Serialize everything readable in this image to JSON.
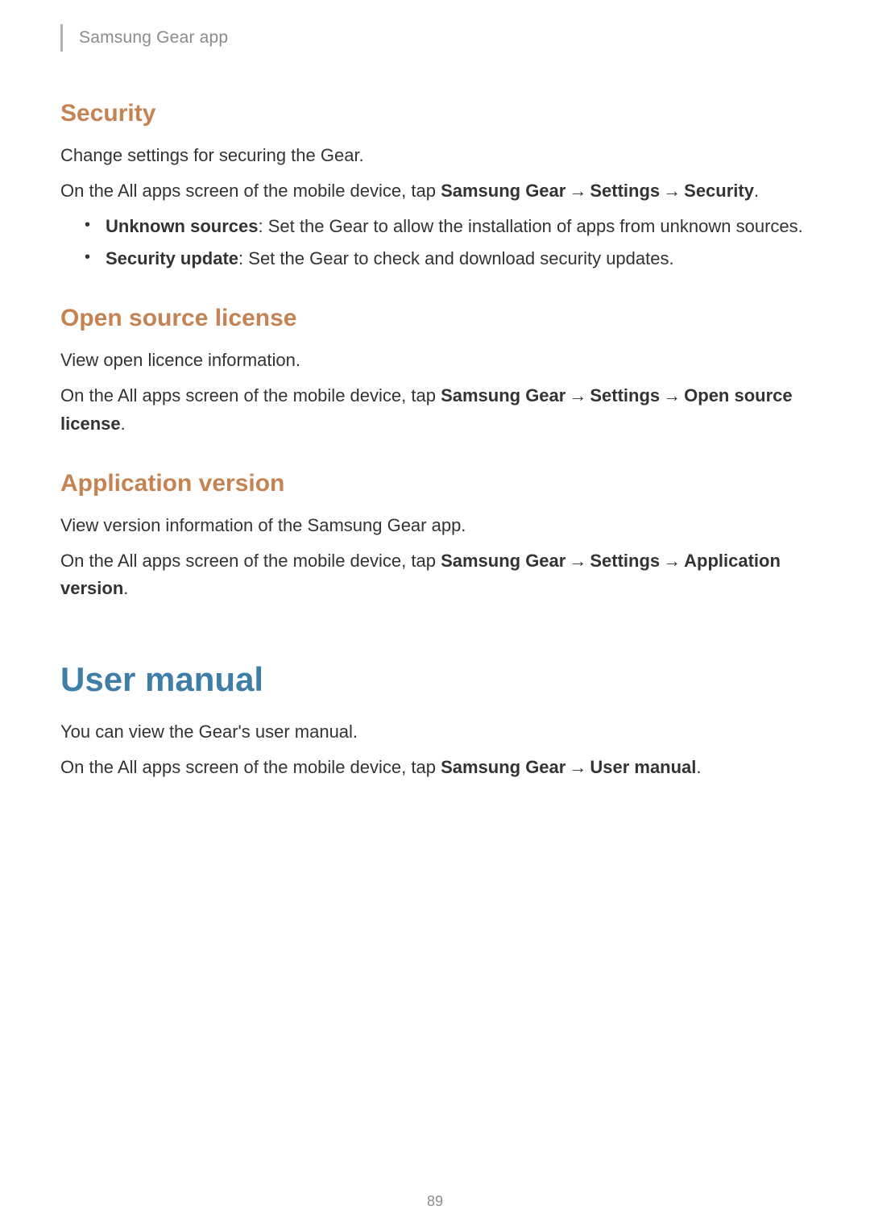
{
  "header": {
    "section_title": "Samsung Gear app"
  },
  "arrow": "→",
  "security": {
    "heading": "Security",
    "intro": "Change settings for securing the Gear.",
    "nav_prefix": "On the All apps screen of the mobile device, tap ",
    "nav_app": "Samsung Gear",
    "nav_settings": "Settings",
    "nav_target": "Security",
    "period": ".",
    "bullets": [
      {
        "label": "Unknown sources",
        "desc": ": Set the Gear to allow the installation of apps from unknown sources."
      },
      {
        "label": "Security update",
        "desc": ": Set the Gear to check and download security updates."
      }
    ]
  },
  "open_source": {
    "heading": "Open source license",
    "intro": "View open licence information.",
    "nav_prefix": "On the All apps screen of the mobile device, tap ",
    "nav_app": "Samsung Gear",
    "nav_settings": "Settings",
    "nav_target": "Open source license",
    "period": "."
  },
  "app_version": {
    "heading": "Application version",
    "intro": "View version information of the Samsung Gear app.",
    "nav_prefix": "On the All apps screen of the mobile device, tap ",
    "nav_app": "Samsung Gear",
    "nav_settings": "Settings",
    "nav_target": "Application version",
    "period": "."
  },
  "user_manual": {
    "heading": "User manual",
    "intro": "You can view the Gear's user manual.",
    "nav_prefix": "On the All apps screen of the mobile device, tap ",
    "nav_app": "Samsung Gear",
    "nav_target": "User manual",
    "period": "."
  },
  "page_number": "89"
}
